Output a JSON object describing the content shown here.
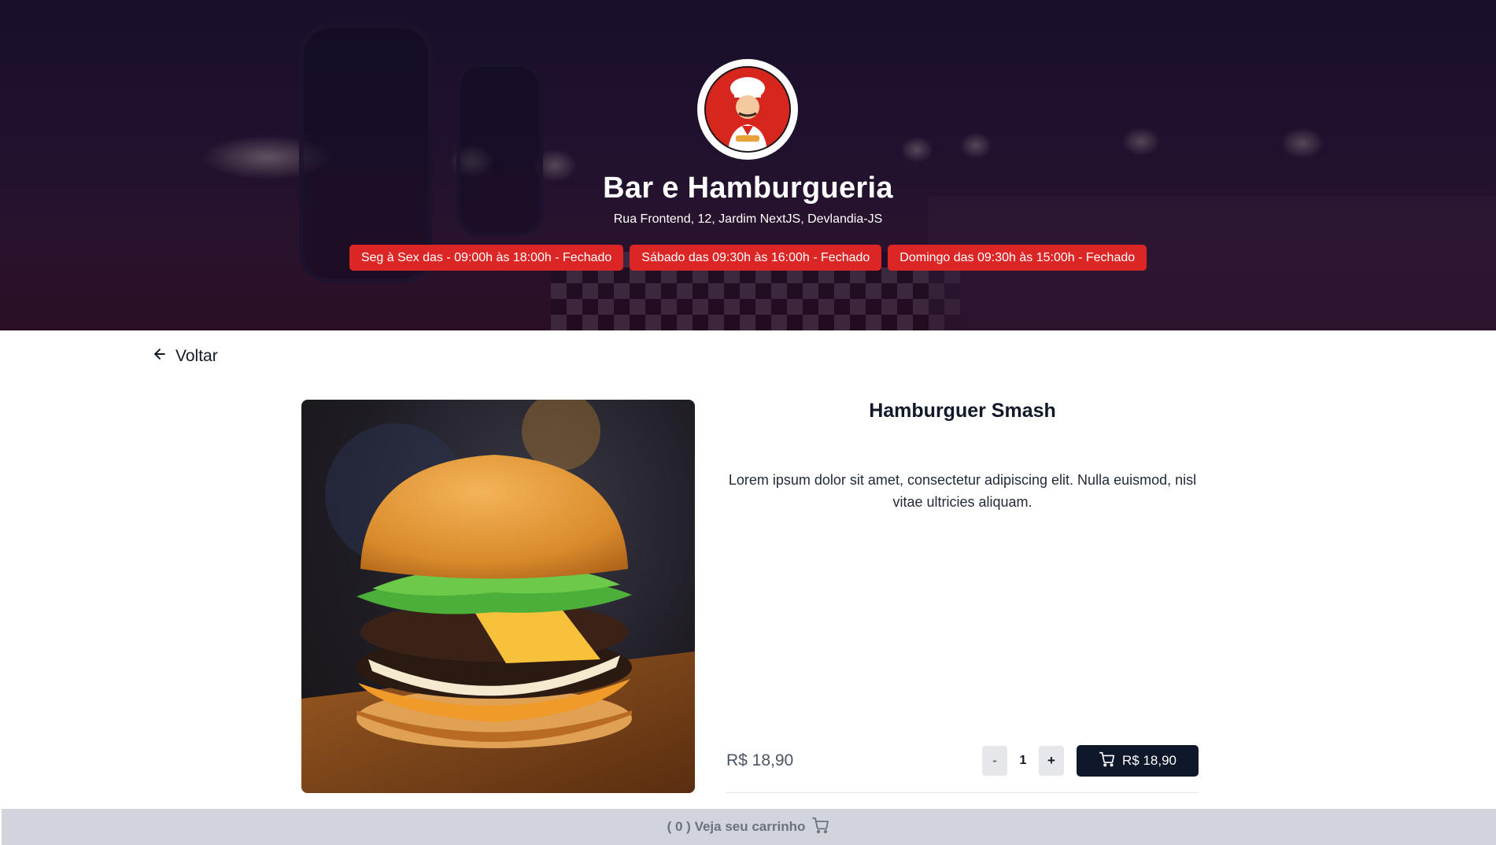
{
  "restaurant": {
    "name": "Bar e Hamburgueria",
    "address": "Rua Frontend, 12, Jardim NextJS, Devlandia-JS",
    "hours": [
      "Seg à Sex das - 09:00h às 18:00h - Fechado",
      "Sábado das 09:30h às 16:00h - Fechado",
      "Domingo das 09:30h às 15:00h - Fechado"
    ],
    "logo_icon": "chef-logo-icon"
  },
  "nav": {
    "back_label": "Voltar",
    "back_icon": "arrow-left-icon"
  },
  "product": {
    "name": "Hamburguer Smash",
    "description": "Lorem ipsum dolor sit amet, consectetur adipiscing elit. Nulla euismod, nisl vitae ultricies aliquam.",
    "price": "R$ 18,90",
    "image_icon": "burger-photo"
  },
  "order": {
    "minus_label": "-",
    "quantity": "1",
    "plus_label": "+",
    "add_button_price": "R$ 18,90",
    "add_button_icon": "cart-icon"
  },
  "cart": {
    "label": "( 0 ) Veja seu carrinho",
    "icon": "cart-icon"
  },
  "colors": {
    "badge_red": "#dc2626",
    "button_dark": "#0f172a",
    "cart_bar": "#d1d5db"
  }
}
